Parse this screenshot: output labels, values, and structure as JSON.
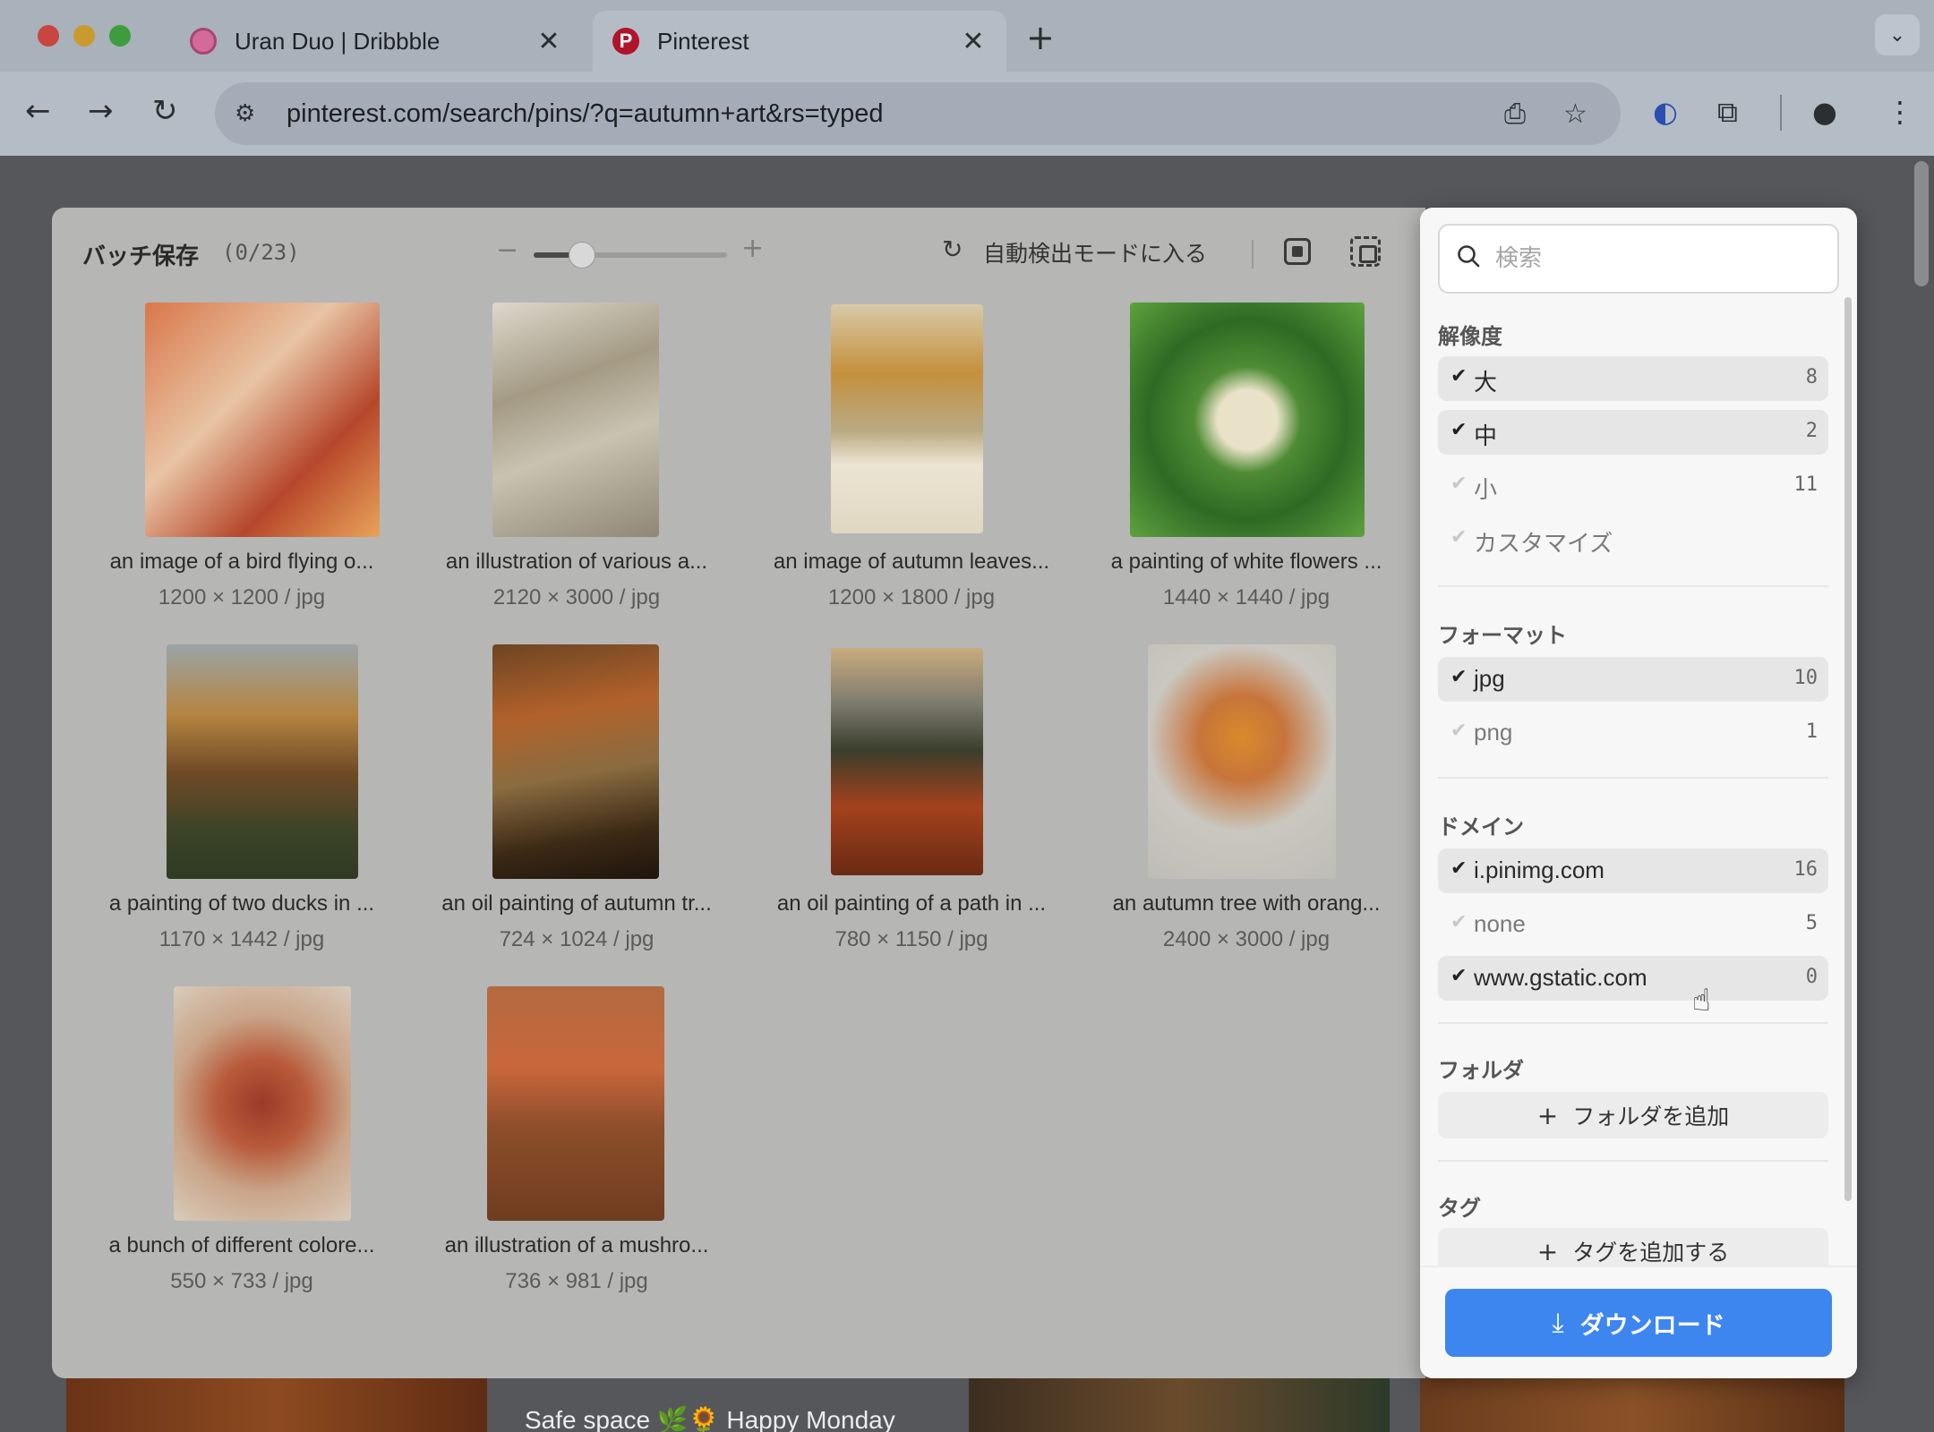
{
  "browser": {
    "tabs": [
      {
        "title": "Uran Duo | Dribbble",
        "close": "✕"
      },
      {
        "title": "Pinterest",
        "close": "✕"
      }
    ],
    "url": "pinterest.com/search/pins/?q=autumn+art&rs=typed"
  },
  "background": {
    "caption_text": "Safe space 🌿🌻 Happy Monday"
  },
  "modal": {
    "title": "バッチ保存",
    "count": "(0/23)",
    "zoom_level": 0.25,
    "auto_detect_label": "自動検出モードに入る",
    "items": [
      {
        "caption": "an image of a bird flying o...",
        "meta": "1200 × 1200 / jpg"
      },
      {
        "caption": "an illustration of various a...",
        "meta": "2120 × 3000 / jpg"
      },
      {
        "caption": "an image of autumn leaves...",
        "meta": "1200 × 1800 / jpg"
      },
      {
        "caption": "a painting of white flowers ...",
        "meta": "1440 × 1440 / jpg"
      },
      {
        "caption": "a painting of two ducks in ...",
        "meta": "1170 × 1442 / jpg"
      },
      {
        "caption": "an oil painting of autumn tr...",
        "meta": "724 × 1024 / jpg"
      },
      {
        "caption": "an oil painting of a path in ...",
        "meta": "780 × 1150 / jpg"
      },
      {
        "caption": "an autumn tree with orang...",
        "meta": "2400 × 3000 / jpg"
      },
      {
        "caption": "a bunch of different colore...",
        "meta": "550 × 733 / jpg"
      },
      {
        "caption": "an illustration of a mushro...",
        "meta": "736 × 981 / jpg"
      }
    ]
  },
  "filter_panel": {
    "search_placeholder": "検索",
    "resolution": {
      "label": "解像度",
      "options": [
        {
          "label": "大",
          "count": "8",
          "checked": true
        },
        {
          "label": "中",
          "count": "2",
          "checked": true
        },
        {
          "label": "小",
          "count": "11",
          "checked": false
        },
        {
          "label": "カスタマイズ",
          "count": "",
          "checked": false
        }
      ]
    },
    "format": {
      "label": "フォーマット",
      "options": [
        {
          "label": "jpg",
          "count": "10",
          "checked": true
        },
        {
          "label": "png",
          "count": "1",
          "checked": false
        }
      ]
    },
    "domain": {
      "label": "ドメイン",
      "options": [
        {
          "label": "i.pinimg.com",
          "count": "16",
          "checked": true
        },
        {
          "label": "none",
          "count": "5",
          "checked": false
        },
        {
          "label": "www.gstatic.com",
          "count": "0",
          "checked": true
        }
      ]
    },
    "folder": {
      "label": "フォルダ",
      "add_label": "フォルダを追加"
    },
    "tag": {
      "label": "タグ",
      "add_label": "タグを追加する"
    },
    "download_label": "ダウンロード",
    "colors": {
      "accent": "#3d86f0"
    }
  }
}
